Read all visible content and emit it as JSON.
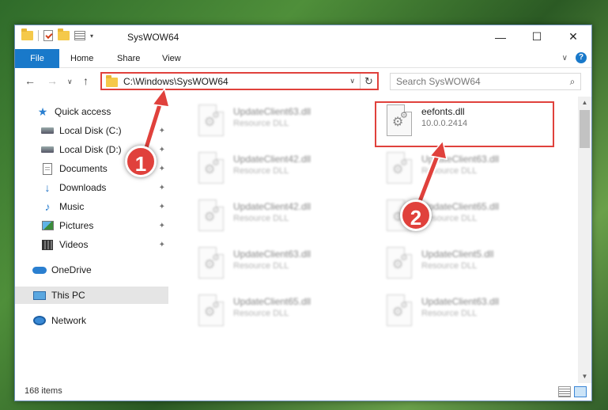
{
  "window": {
    "title": "SysWOW64",
    "minimize_glyph": "—",
    "maximize_glyph": "☐",
    "close_glyph": "✕"
  },
  "ribbon": {
    "tabs": [
      {
        "label": "File"
      },
      {
        "label": "Home"
      },
      {
        "label": "Share"
      },
      {
        "label": "View"
      }
    ],
    "collapse_glyph": "∨",
    "help_glyph": "?"
  },
  "address": {
    "path": "C:\\Windows\\SysWOW64",
    "dropdown_glyph": "∨",
    "refresh_glyph": "↻",
    "back_glyph": "←",
    "forward_glyph": "→",
    "recent_glyph": "∨",
    "up_glyph": "↑"
  },
  "search": {
    "placeholder": "Search SysWOW64",
    "icon_glyph": "⌕"
  },
  "sidebar": {
    "items": [
      {
        "label": "Quick access",
        "icon": "star-icon"
      },
      {
        "label": "Local Disk (C:)",
        "icon": "disk-icon",
        "pinned": true
      },
      {
        "label": "Local Disk (D:)",
        "icon": "disk-icon",
        "pinned": true
      },
      {
        "label": "Documents",
        "icon": "document-icon",
        "pinned": true
      },
      {
        "label": "Downloads",
        "icon": "download-icon",
        "pinned": true
      },
      {
        "label": "Music",
        "icon": "music-icon",
        "pinned": true
      },
      {
        "label": "Pictures",
        "icon": "pictures-icon",
        "pinned": true
      },
      {
        "label": "Videos",
        "icon": "videos-icon",
        "pinned": true
      },
      {
        "label": "OneDrive",
        "icon": "cloud-icon"
      },
      {
        "label": "This PC",
        "icon": "computer-icon",
        "selected": true
      },
      {
        "label": "Network",
        "icon": "network-icon"
      }
    ],
    "pin_glyph": "📌"
  },
  "files": [
    {
      "name": "UpdateClient63.dll",
      "desc": "Resource DLL",
      "blurred": true
    },
    {
      "name": "eefonts.dll",
      "desc": "10.0.0.2414",
      "blurred": false
    },
    {
      "name": "UpdateClient42.dll",
      "desc": "Resource DLL",
      "blurred": true
    },
    {
      "name": "UpdateClient63.dll",
      "desc": "Resource DLL",
      "blurred": true
    },
    {
      "name": "UpdateClient42.dll",
      "desc": "Resource DLL",
      "blurred": true
    },
    {
      "name": "UpdateClient65.dll",
      "desc": "Resource DLL",
      "blurred": true
    },
    {
      "name": "UpdateClient63.dll",
      "desc": "Resource DLL",
      "blurred": true
    },
    {
      "name": "UpdateClient5.dll",
      "desc": "Resource DLL",
      "blurred": true
    },
    {
      "name": "UpdateClient65.dll",
      "desc": "Resource DLL",
      "blurred": true
    },
    {
      "name": "UpdateClient63.dll",
      "desc": "Resource DLL",
      "blurred": true
    }
  ],
  "status": {
    "item_count": "168 items"
  },
  "annotations": {
    "step1": "1",
    "step2": "2",
    "highlight_color": "#e0413c"
  },
  "colors": {
    "accent": "#1979ca",
    "annotation": "#e0413c"
  }
}
